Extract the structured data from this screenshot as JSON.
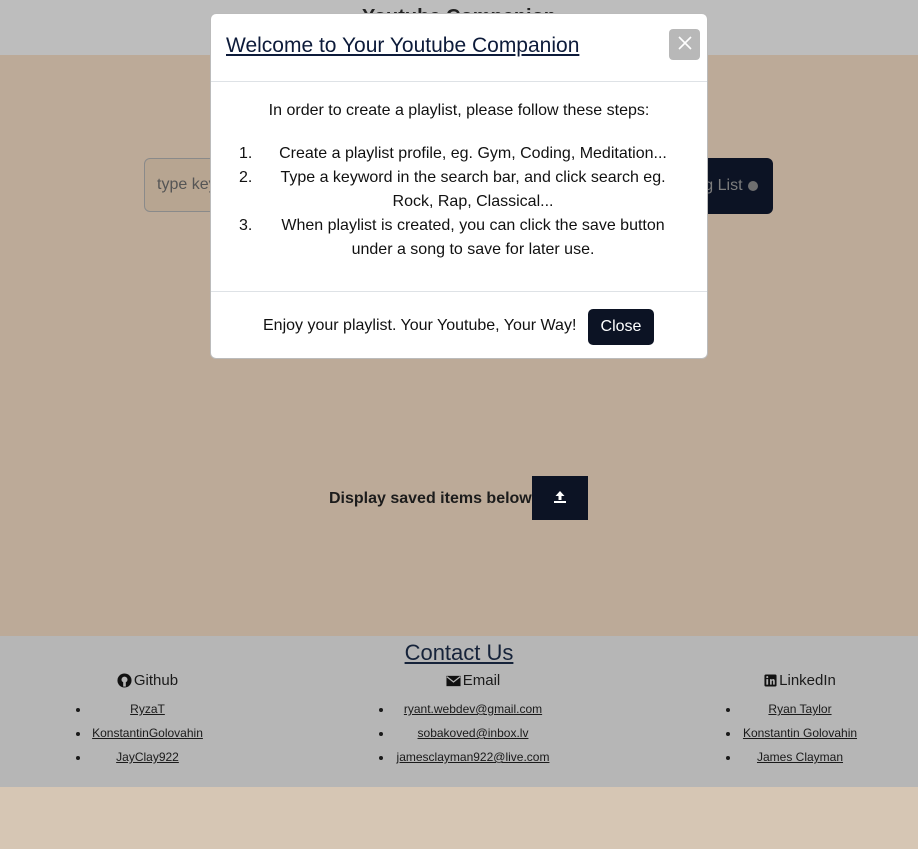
{
  "header": {
    "title": "Youtube Companion"
  },
  "search": {
    "placeholder": "type keyword",
    "button_label": "Song List"
  },
  "saved": {
    "label": "Display saved items below"
  },
  "modal": {
    "title": "Welcome to Your Youtube Companion",
    "intro": "In order to create a playlist, please follow these steps:",
    "steps": [
      {
        "num": "1.",
        "text": "Create a playlist profile, eg. Gym, Coding, Meditation..."
      },
      {
        "num": "2.",
        "text": "Type a keyword in the search bar, and click search eg. Rock, Rap, Classical..."
      },
      {
        "num": "3.",
        "text": "When playlist is created, you can click the save button under a song to save for later use."
      }
    ],
    "footer_text": "Enjoy your playlist. Your Youtube, Your Way!",
    "close_label": "Close"
  },
  "footer": {
    "title": "Contact Us",
    "github": {
      "label": "Github",
      "items": [
        "RyzaT",
        "KonstantinGolovahin",
        "JayClay922"
      ]
    },
    "email": {
      "label": "Email",
      "items": [
        "ryant.webdev@gmail.com",
        "sobakoved@inbox.lv",
        "jamesclayman922@live.com"
      ]
    },
    "linkedin": {
      "label": "LinkedIn",
      "items": [
        "Ryan Taylor",
        "Konstantin Golovahin",
        "James Clayman"
      ]
    }
  },
  "colors": {
    "dark_button": "#0c1324",
    "overlay_bg": "#bcaa98",
    "footer_bg": "#b6b6b6"
  }
}
